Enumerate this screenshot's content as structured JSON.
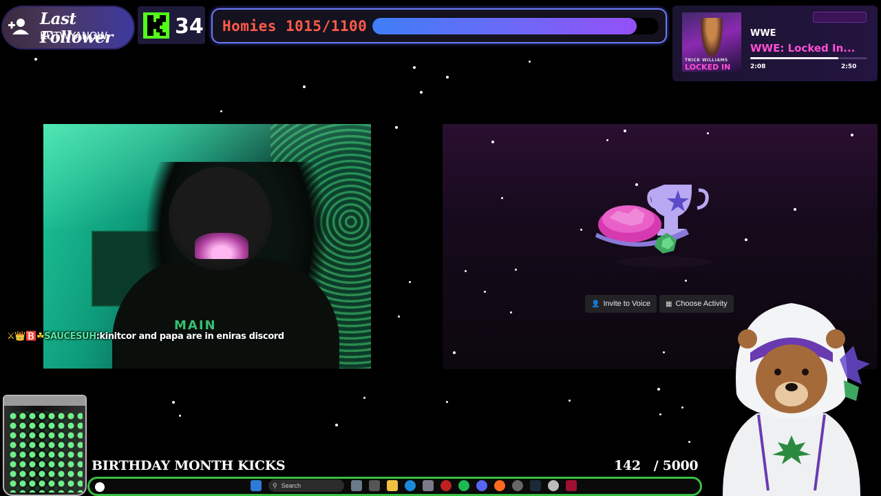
{
  "follower": {
    "title": "Last Follower",
    "name": "KUTWYANOW",
    "icon": "add-user-icon"
  },
  "kick": {
    "icon": "kick-logo-icon",
    "count": "34",
    "brand_color": "#53fc18"
  },
  "homies_goal": {
    "label": "Homies 1015/1100",
    "progress": 0.923,
    "colors": [
      "#3f7ef7",
      "#9450f7"
    ]
  },
  "now_playing": {
    "album_label_top": "TRICK WILLIAMS",
    "album_label_bottom": "LOCKED IN",
    "artist": "WWE",
    "title": "WWE: Locked In...",
    "elapsed": "2:08",
    "total": "2:50",
    "progress": 0.75,
    "accent": "#ff4fd4"
  },
  "webcam": {
    "shirt_text": "MAIN"
  },
  "chat": {
    "badges": "⚔👑🅱️☘",
    "username": "SAUCESUH",
    "separator": ":",
    "message": "kinitcor and papa are in eniras discord"
  },
  "discord": {
    "invite_label": "Invite to Voice",
    "invite_icon": "person-add-icon",
    "activity_label": "Choose Activity",
    "activity_icon": "grid-icon"
  },
  "birthday_goal": {
    "title": "BIRTHDAY MONTH KICKS",
    "current": "142",
    "target": "/ 5000",
    "progress": 0.028,
    "bar_color": "#38c040"
  },
  "taskbar": {
    "search_placeholder": "Search"
  }
}
